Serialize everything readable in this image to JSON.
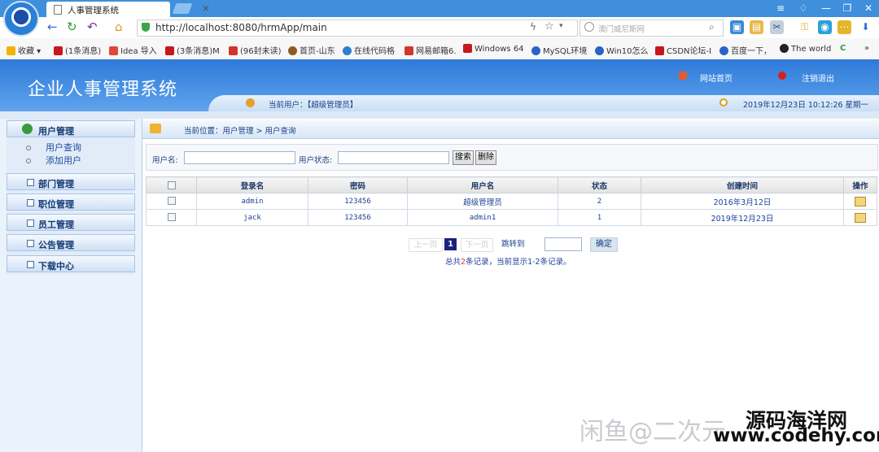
{
  "browser": {
    "tab_title": "人事管理系统",
    "tab_close": "×",
    "url": "http://localhost:8080/hrmApp/main",
    "search_placeholder": "澳门威尼斯网",
    "bookmarks": [
      {
        "label": "收藏",
        "color": "#f2b400"
      },
      {
        "label": "(1条消息)",
        "color": "#c8161d"
      },
      {
        "label": "Idea 导入",
        "color": "#e0483a"
      },
      {
        "label": "(3条消息)M",
        "color": "#c8161d"
      },
      {
        "label": "(96封未读)",
        "color": "#d0362b"
      },
      {
        "label": "首页-山东",
        "color": "#8a5a22"
      },
      {
        "label": "在线代码格",
        "color": "#2d7fd2"
      },
      {
        "label": "网易邮箱6.",
        "color": "#d0362b"
      },
      {
        "label": "Windows 64",
        "color": "#c8161d"
      },
      {
        "label": "MySQL环境",
        "color": "#2a62c8"
      },
      {
        "label": "Win10怎么",
        "color": "#2a62c8"
      },
      {
        "label": "CSDN论坛-I",
        "color": "#c8161d"
      },
      {
        "label": "百度一下，",
        "color": "#2a62c8"
      },
      {
        "label": "The world",
        "color": "#222"
      }
    ]
  },
  "header": {
    "app_title": "企业人事管理系统",
    "home_link": "网站首页",
    "logout_link": "注销退出",
    "current_user": "当前用户：【超级管理员】",
    "datetime": "2019年12月23日 10:12:26 星期一"
  },
  "sidebar": {
    "groups": [
      {
        "label": "用户管理",
        "items": [
          "用户查询",
          "添加用户"
        ]
      },
      {
        "label": "部门管理"
      },
      {
        "label": "职位管理"
      },
      {
        "label": "员工管理"
      },
      {
        "label": "公告管理"
      },
      {
        "label": "下载中心"
      }
    ]
  },
  "breadcrumb": "当前位置：用户管理 > 用户查询",
  "search": {
    "username_label": "用户名:",
    "username_value": "",
    "status_label": "用户状态:",
    "status_value": "",
    "search_btn": "搜索",
    "delete_btn": "删除"
  },
  "table": {
    "headers": [
      "登录名",
      "密码",
      "用户名",
      "状态",
      "创建时间",
      "操作"
    ],
    "rows": [
      {
        "login": "admin",
        "password": "123456",
        "username": "超级管理员",
        "status": "2",
        "created": "2016年3月12日"
      },
      {
        "login": "jack",
        "password": "123456",
        "username": "admin1",
        "status": "1",
        "created": "2019年12月23日"
      }
    ]
  },
  "pager": {
    "prev": "上一页",
    "current": "1",
    "next": "下一页",
    "jump_label": "跳转到",
    "ok": "确定",
    "summary_pre": "总共",
    "summary_total": "2",
    "summary_post": "条记录，当前显示1-2条记录。"
  },
  "watermark": {
    "faded": "闲鱼@二次元",
    "line1": "源码海洋网",
    "line2": "www.codehy.com"
  }
}
